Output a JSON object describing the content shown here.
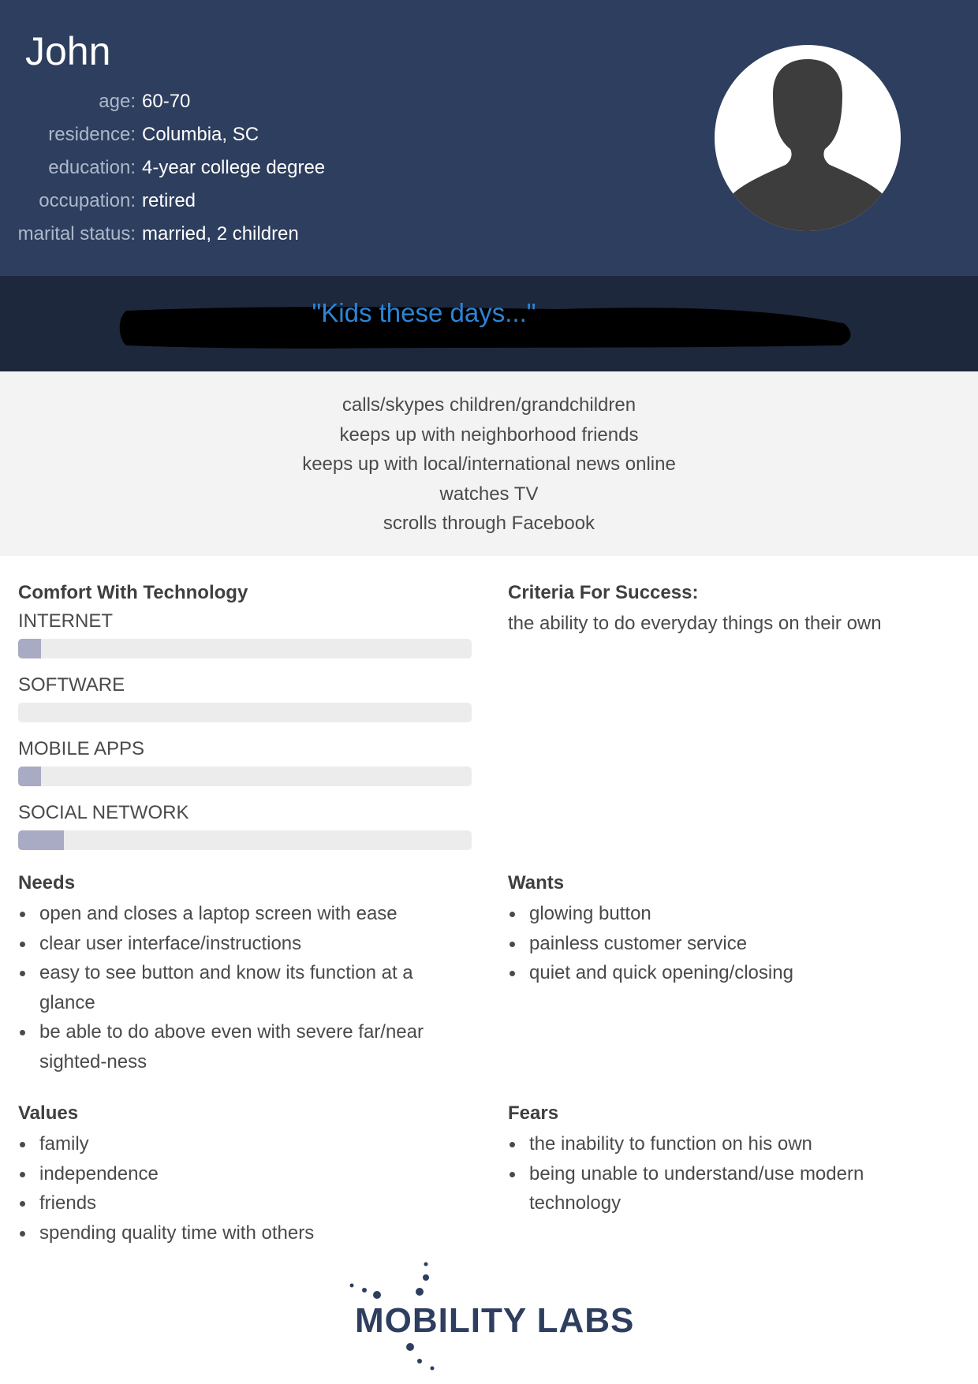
{
  "persona": {
    "name": "John",
    "facts": [
      {
        "label": "age:",
        "value": "60-70"
      },
      {
        "label": "residence:",
        "value": "Columbia, SC"
      },
      {
        "label": "education:",
        "value": "4-year college degree"
      },
      {
        "label": "occupation:",
        "value": "retired"
      },
      {
        "label": "marital status:",
        "value": "married, 2 children"
      }
    ],
    "avatar_icon": "person-silhouette-icon"
  },
  "quote": "\"Kids these days...\"",
  "activities": [
    "calls/skypes children/grandchildren",
    "keeps up with neighborhood friends",
    "keeps up with local/international news online",
    "watches TV",
    "scrolls through Facebook"
  ],
  "comfort": {
    "title": "Comfort With Technology",
    "items": [
      {
        "label": "INTERNET",
        "level": 0.05
      },
      {
        "label": "SOFTWARE",
        "level": 0.0
      },
      {
        "label": "MOBILE APPS",
        "level": 0.05
      },
      {
        "label": "SOCIAL NETWORK",
        "level": 0.1
      }
    ]
  },
  "criteria": {
    "title": "Criteria For Success:",
    "text": "the ability to do everyday things on their own"
  },
  "needs": {
    "title": "Needs",
    "items": [
      "open and closes a laptop screen with ease",
      "clear user interface/instructions",
      "easy to see button and know its function at a glance",
      "be able to do above even with severe far/near sighted-ness"
    ]
  },
  "wants": {
    "title": "Wants",
    "items": [
      "glowing button",
      "painless customer service",
      "quiet and quick opening/closing"
    ]
  },
  "values": {
    "title": "Values",
    "items": [
      "family",
      "independence",
      "friends",
      "spending quality time with others"
    ]
  },
  "fears": {
    "title": "Fears",
    "items": [
      "the inability to function on his own",
      "being unable to understand/use modern technology"
    ]
  },
  "logo": {
    "text": "MOBILITY LABS"
  },
  "colors": {
    "header_bg": "#2d3e5e",
    "quote_band_bg": "#1d283d",
    "quote_text": "#2c85d6",
    "activities_bg": "#f3f3f3",
    "bar_track": "#ececec",
    "bar_fill": "#a9abc4"
  }
}
